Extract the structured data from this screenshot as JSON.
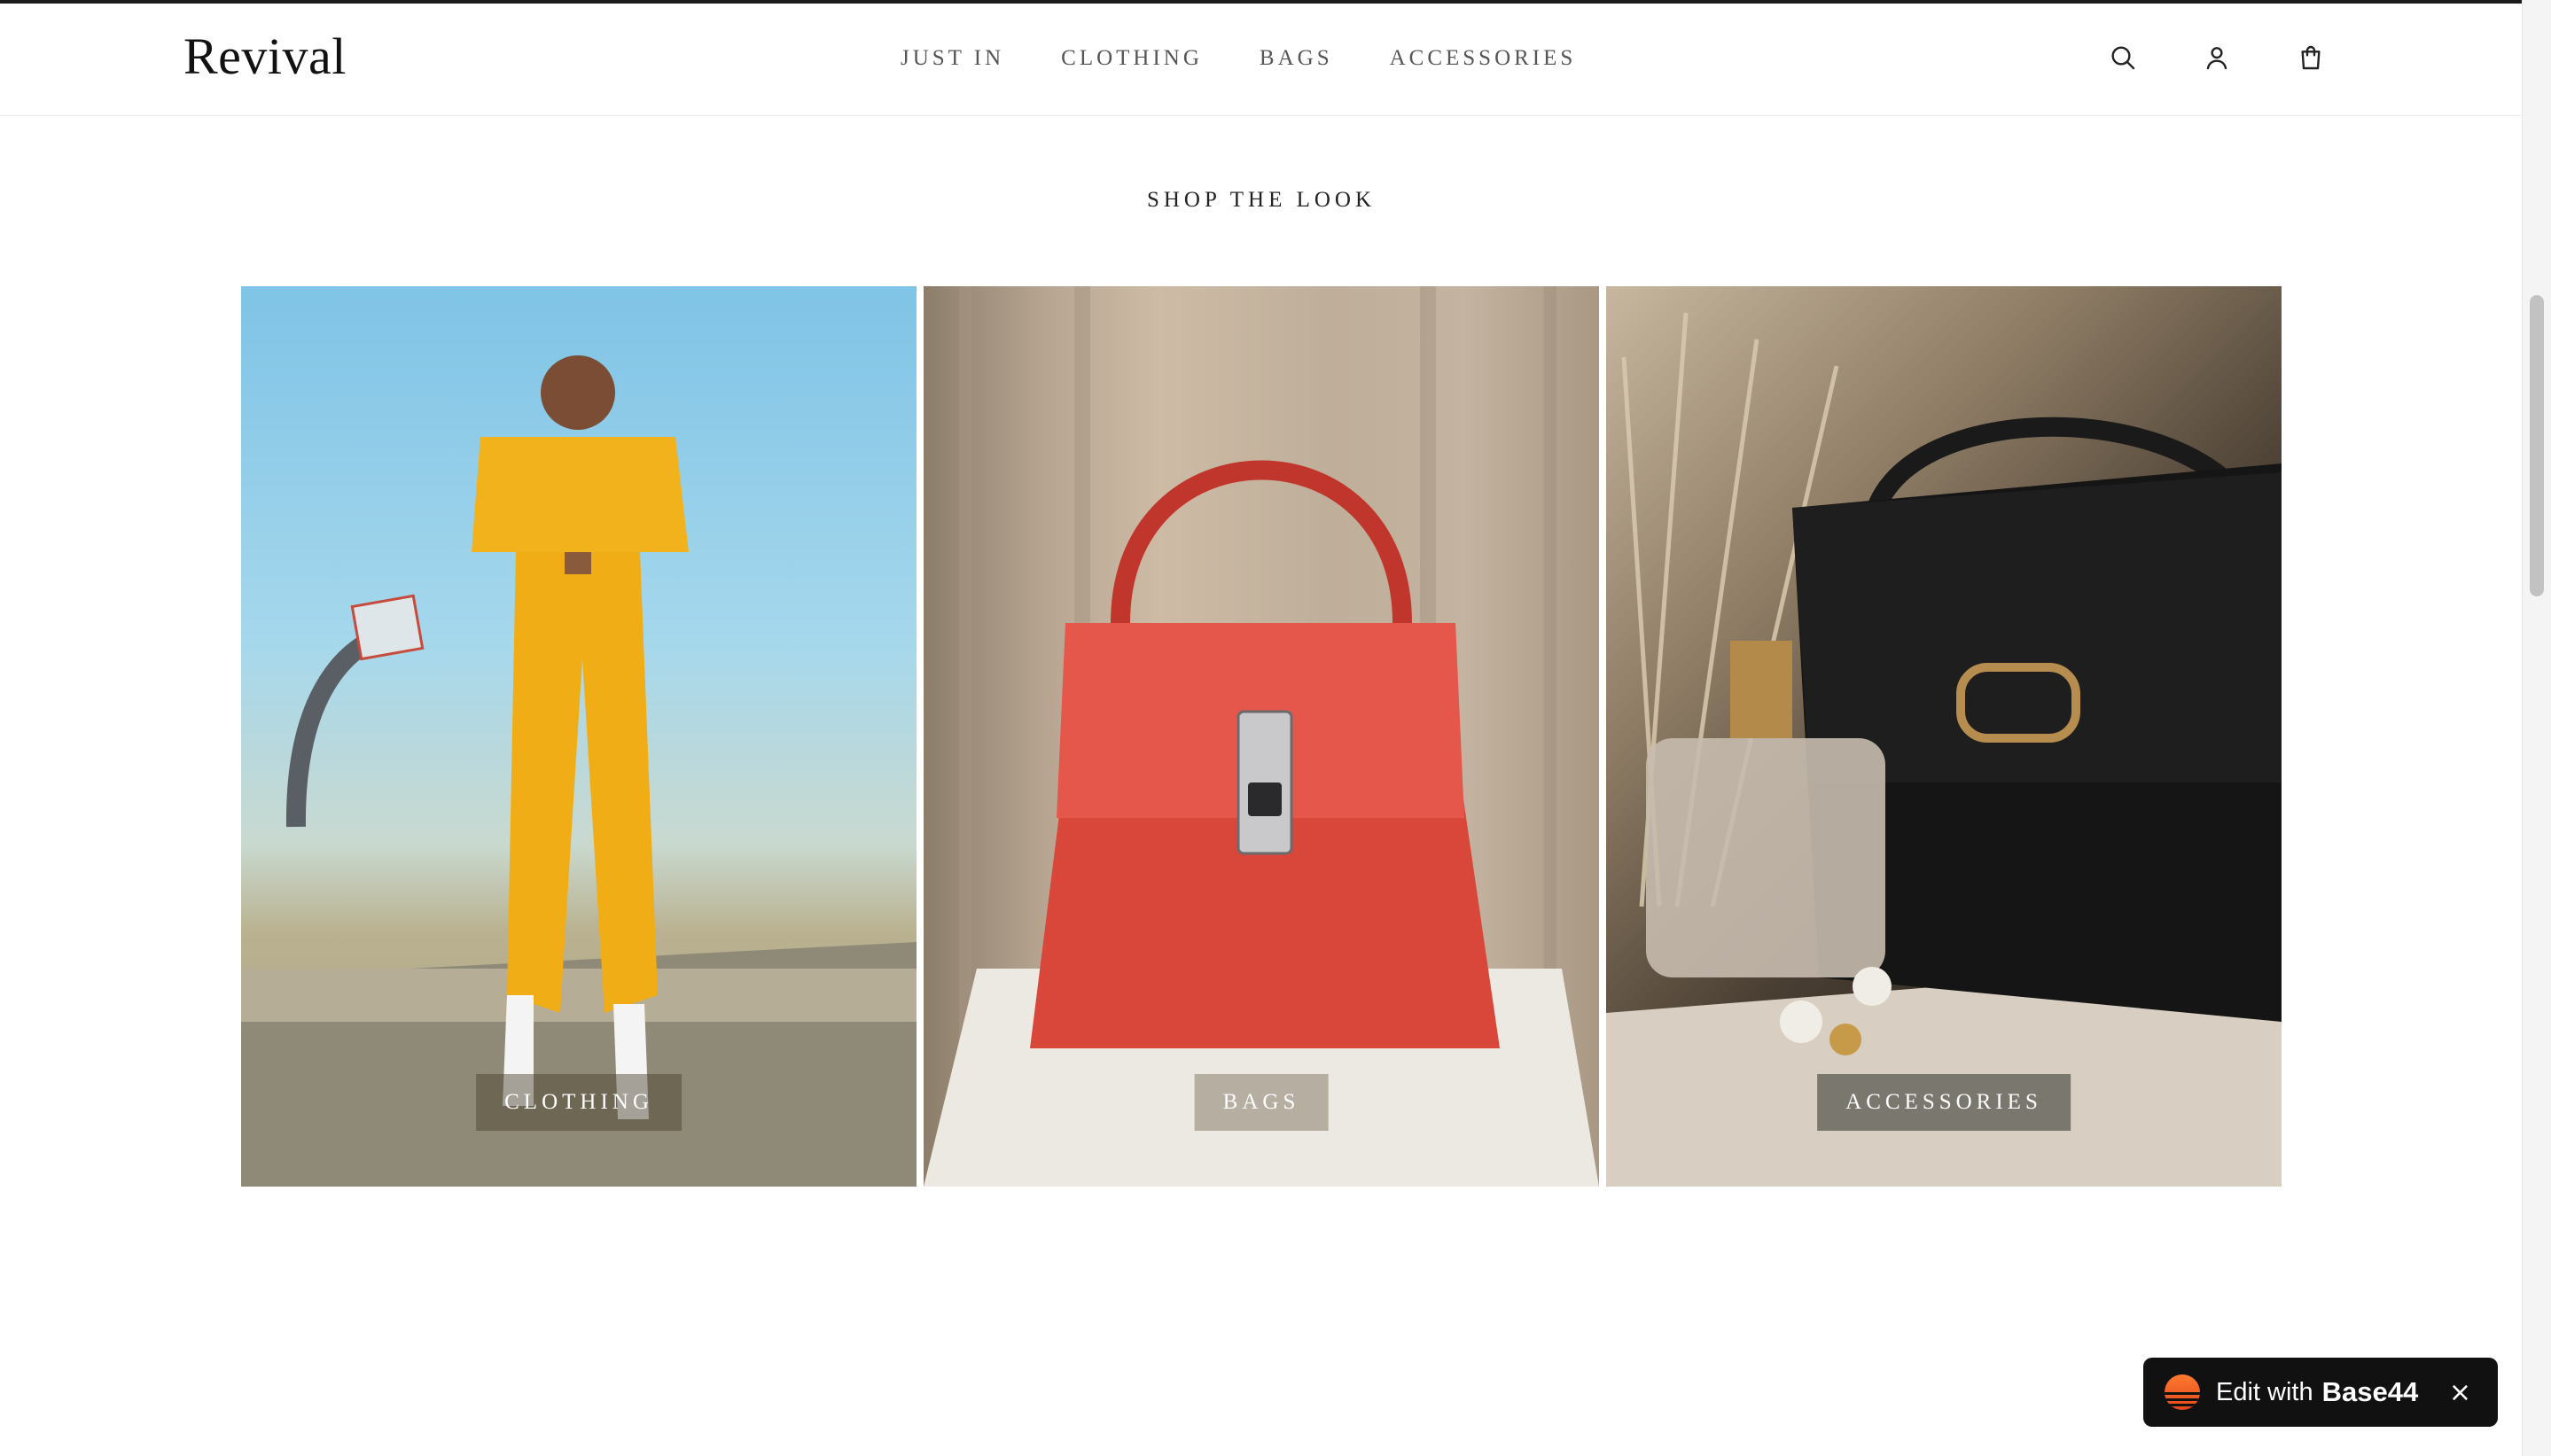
{
  "header": {
    "logo": "Revival",
    "nav": [
      {
        "label": "JUST IN"
      },
      {
        "label": "CLOTHING"
      },
      {
        "label": "BAGS"
      },
      {
        "label": "ACCESSORIES"
      }
    ],
    "icons": [
      "search-icon",
      "account-icon",
      "cart-icon"
    ]
  },
  "section": {
    "title": "SHOP THE LOOK"
  },
  "tiles": [
    {
      "label": "CLOTHING",
      "image": "woman in yellow tracksuit by basketball hoop"
    },
    {
      "label": "BAGS",
      "image": "red leather handbag"
    },
    {
      "label": "ACCESSORIES",
      "image": "black handbag with perfume and earrings"
    }
  ],
  "badge": {
    "text": "Edit with",
    "brand": "Base44",
    "close": "×"
  },
  "colors": {
    "text": "#111111",
    "nav": "#555555",
    "badge_bg": "#111111",
    "badge_logo": "#e2471b"
  }
}
